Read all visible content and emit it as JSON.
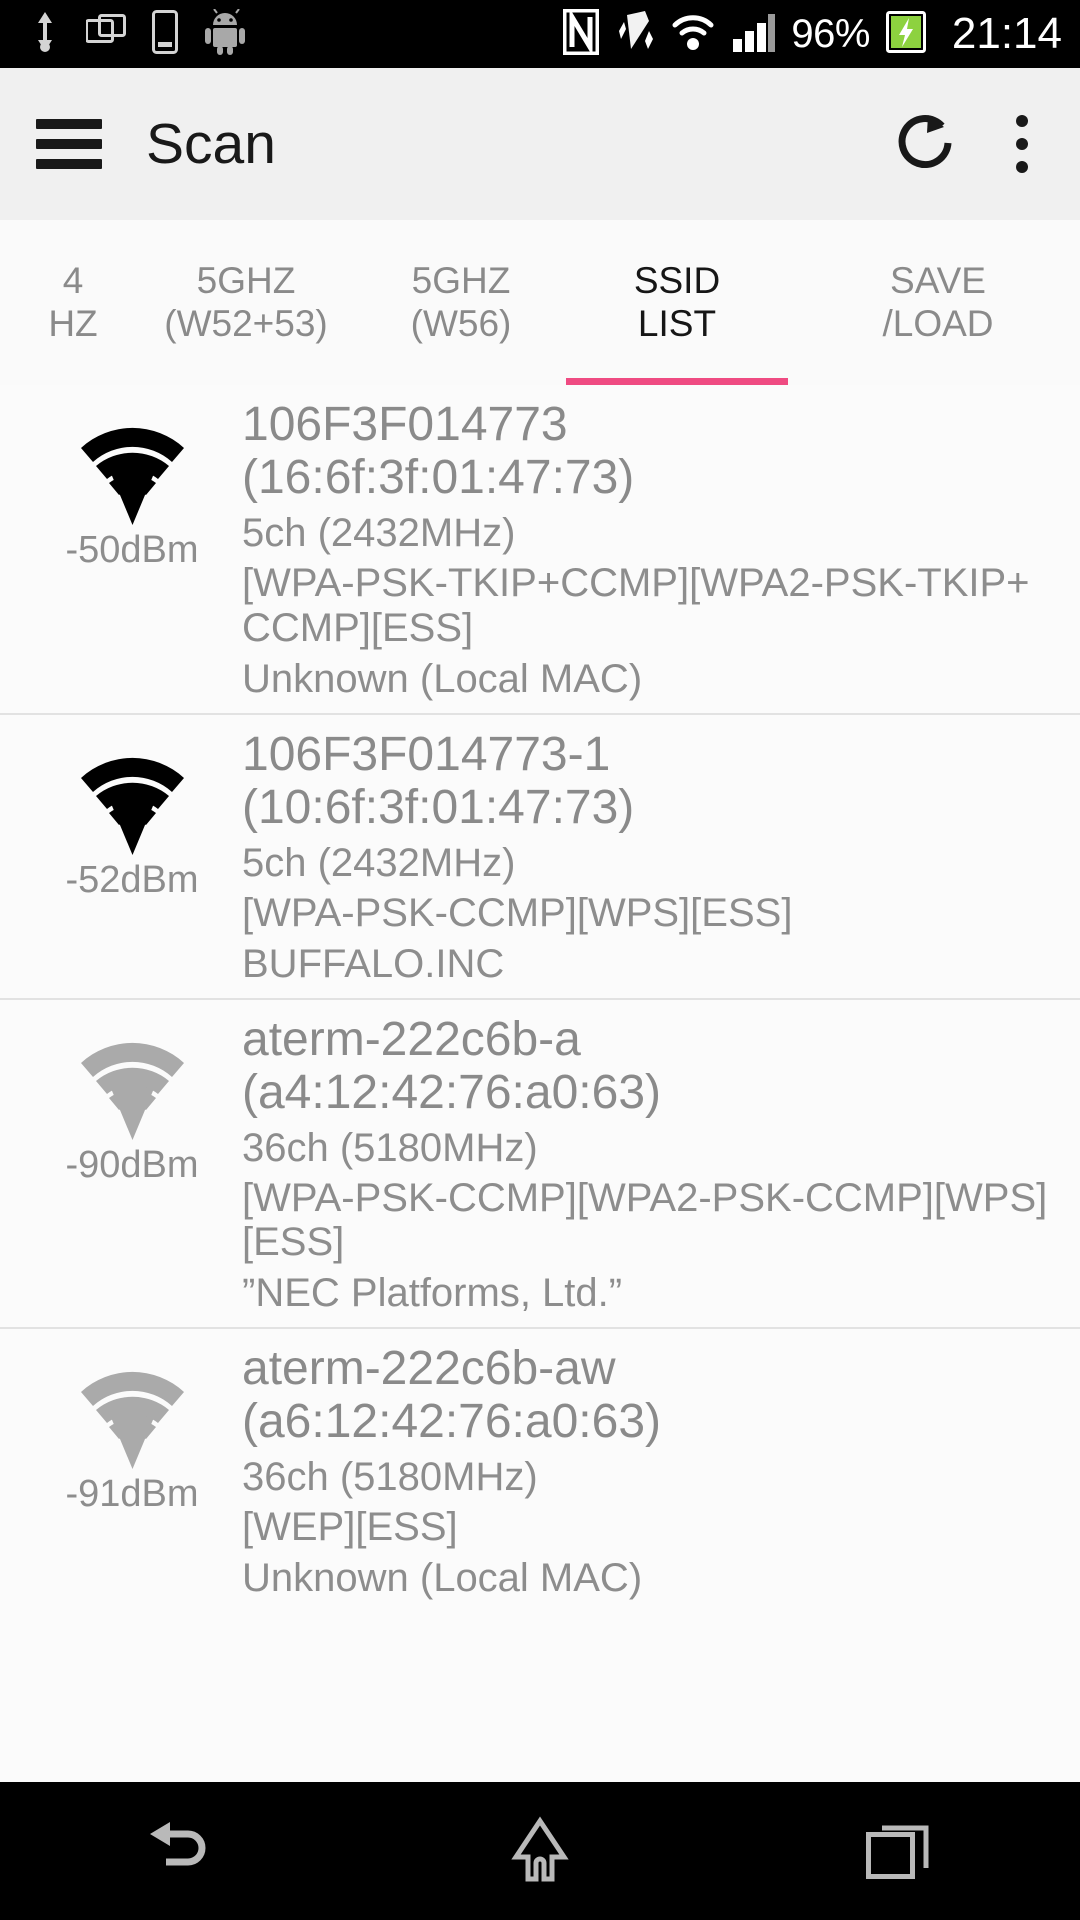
{
  "status_bar": {
    "left_icons": [
      "usb-icon",
      "screen-cast-icon",
      "phone-icon",
      "android-icon"
    ],
    "right_icons": [
      "nfc-icon",
      "vibrate-icon",
      "wifi-icon",
      "cellular-signal-icon"
    ],
    "battery_percent": "96%",
    "battery_icon": "battery-charging-icon",
    "clock": "21:14"
  },
  "app_bar": {
    "menu_icon": "hamburger-menu-icon",
    "title": "Scan",
    "refresh_icon": "refresh-icon",
    "overflow_icon": "overflow-menu-icon"
  },
  "tabs": {
    "active_index": 3,
    "indicator_color": "#ef4b82",
    "items": [
      {
        "line1": "4",
        "line2": "HZ",
        "active": false
      },
      {
        "line1": "5GHZ",
        "line2": "(W52+53)",
        "active": false
      },
      {
        "line1": "5GHZ",
        "line2": "(W56)",
        "active": false
      },
      {
        "line1": "SSID",
        "line2": "LIST",
        "active": true
      },
      {
        "line1": "SAVE",
        "line2": "/LOAD",
        "active": false
      }
    ]
  },
  "ssid_list": [
    {
      "ssid": "106F3F014773",
      "bssid": "(16:6f:3f:01:47:73)",
      "channel": "5ch (2432MHz)",
      "capabilities": "[WPA-PSK-TKIP+CCMP][WPA2-PSK-TKIP+CCMP][ESS]",
      "vendor": "Unknown (Local MAC)",
      "dbm": "-50dBm",
      "bars": 4,
      "icon": "wifi-signal-icon",
      "strong": true
    },
    {
      "ssid": "106F3F014773-1",
      "bssid": "(10:6f:3f:01:47:73)",
      "channel": "5ch (2432MHz)",
      "capabilities": "[WPA-PSK-CCMP][WPS][ESS]",
      "vendor": "BUFFALO.INC",
      "dbm": "-52dBm",
      "bars": 4,
      "icon": "wifi-signal-icon",
      "strong": true
    },
    {
      "ssid": "aterm-222c6b-a",
      "bssid": "(a4:12:42:76:a0:63)",
      "channel": "36ch (5180MHz)",
      "capabilities": "[WPA-PSK-CCMP][WPA2-PSK-CCMP][WPS][ESS]",
      "vendor": "”NEC Platforms, Ltd.”",
      "dbm": "-90dBm",
      "bars": 4,
      "icon": "wifi-signal-icon",
      "strong": false
    },
    {
      "ssid": "aterm-222c6b-aw",
      "bssid": "(a6:12:42:76:a0:63)",
      "channel": "36ch (5180MHz)",
      "capabilities": "[WEP][ESS]",
      "vendor": "Unknown (Local MAC)",
      "dbm": "-91dBm",
      "bars": 4,
      "icon": "wifi-signal-icon",
      "strong": false
    }
  ],
  "nav_bar": {
    "back_icon": "back-icon",
    "home_icon": "home-icon",
    "recents_icon": "recent-apps-icon"
  },
  "colors": {
    "accent": "#ef4b82",
    "status_bar_bg": "#000000",
    "app_bar_bg": "#f0f0f0",
    "list_bg": "#fbfbfb",
    "text_muted": "#8d8d8d",
    "signal_strong": "#000000",
    "signal_weak": "#aaaaaa"
  }
}
